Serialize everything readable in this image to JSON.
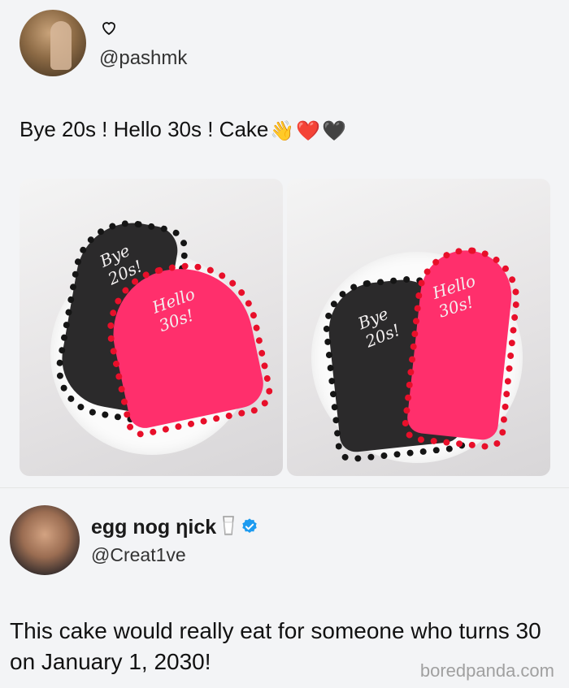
{
  "post1": {
    "handle": "@pashmk",
    "text": "Bye 20s ! Hello 30s ! Cake",
    "emojis": [
      "👋",
      "❤️",
      "🖤"
    ],
    "icons": {
      "like": "heart-outline-icon"
    },
    "images": [
      {
        "alt": "heart-shaped cake split in black and pink halves",
        "black_text": "Bye 20s!",
        "red_text": "Hello 30s!"
      },
      {
        "alt": "heart-shaped cake split in black and pink halves",
        "black_text": "Bye 20s!",
        "red_text": "Hello 30s!"
      }
    ]
  },
  "post2": {
    "name": "egg nog ηick",
    "handle": "@Creat1ve",
    "text": "This cake would really eat for someone who turns 30 on January 1, 2030!",
    "badges": [
      "milk-glass-icon",
      "verified-badge-icon"
    ]
  },
  "watermark": "boredpanda.com",
  "colors": {
    "cake_black": "#2b2a2b",
    "cake_red": "#ff2f6c",
    "verified_blue": "#1d9bf0"
  }
}
